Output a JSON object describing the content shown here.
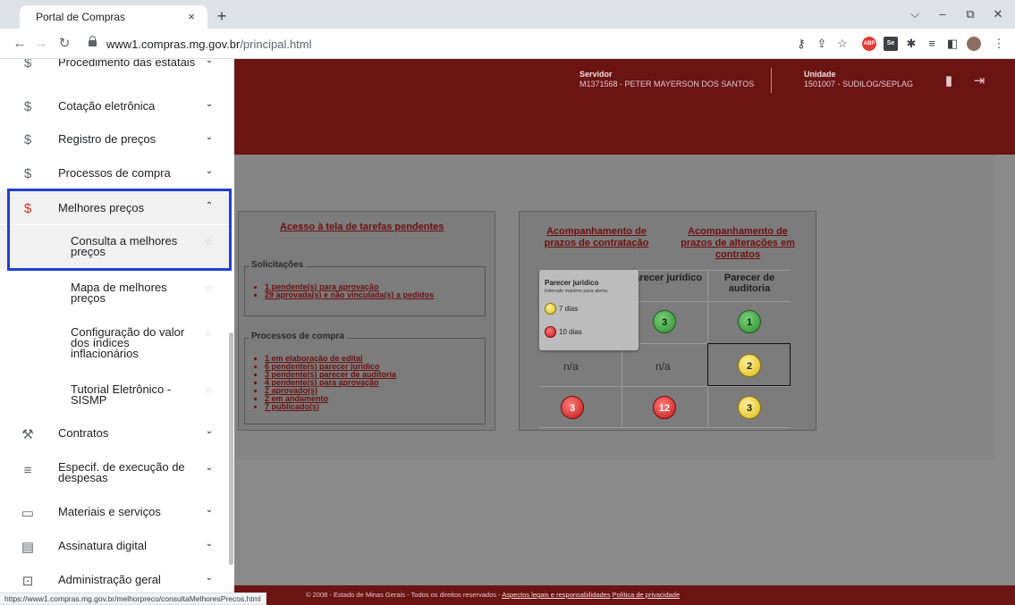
{
  "browser": {
    "tab_title": "Portal de Compras",
    "tab_close": "×",
    "new_tab": "+",
    "url_host": "www1.compras.mg.gov.br",
    "url_path": "/principal.html",
    "status_url": "https://www1.compras.mg.gov.br/melhorpreco/consultaMelhoresPrecos.html"
  },
  "banner": {
    "servidor_label": "Servidor",
    "servidor_value": "M1371568 - PETER MAYERSON DOS SANTOS",
    "unidade_label": "Unidade",
    "unidade_value": "1501007 - SUDILOG/SEPLAG"
  },
  "sidebar": {
    "items": [
      {
        "label": "Procedimento das estatais",
        "icon": "dollar-icon"
      },
      {
        "label": "Cotação eletrônica",
        "icon": "dollar-icon"
      },
      {
        "label": "Registro de preços",
        "icon": "dollar-icon"
      },
      {
        "label": "Processos de compra",
        "icon": "dollar-icon"
      },
      {
        "label": "Melhores preços",
        "icon": "dollar-icon"
      },
      {
        "label": "Contratos",
        "icon": "gavel-icon"
      },
      {
        "label": "Especif. de execução de despesas",
        "icon": "list-check-icon"
      },
      {
        "label": "Materiais e serviços",
        "icon": "book-icon"
      },
      {
        "label": "Assinatura digital",
        "icon": "document-icon"
      },
      {
        "label": "Administração geral",
        "icon": "settings-box-icon"
      }
    ],
    "subitems": [
      {
        "label": "Consulta a melhores preços"
      },
      {
        "label": "Mapa de melhores preços"
      },
      {
        "label": "Configuração do valor dos índices inflacionários"
      },
      {
        "label": "Tutorial Eletrônico - SISMP"
      }
    ]
  },
  "main": {
    "pending_link": "Acesso à tela de tarefas pendentes",
    "solicitacoes": {
      "legend": "Solicitações",
      "items": [
        "1 pendente(s) para aprovação",
        "29 aprovada(s) e não vinculada(s) a pedidos"
      ]
    },
    "processos": {
      "legend": "Processos de compra",
      "items": [
        "1 em elaboração de edital",
        "6 pendente(s) parecer jurídico",
        "3 pendente(s) parecer de auditoria",
        "4 pendente(s) para aprovação",
        "2 aprovado(s)",
        "2 em andamento",
        "7 publicado(s)"
      ]
    },
    "prazos_contratacao": "Acompanhamento de prazos de contratação",
    "prazos_alteracoes": "Acompanhamento de prazos de alterações em contratos",
    "grid": {
      "col_juridico": "Parecer jurídico",
      "col_auditoria": "Parecer de auditoria",
      "row1": {
        "juridico": "3",
        "auditoria": "1"
      },
      "row2": {
        "first": "n/a",
        "juridico": "n/a",
        "auditoria": "2"
      },
      "row3": {
        "first": "3",
        "juridico": "12",
        "auditoria": "3"
      }
    },
    "tooltip": {
      "title": "Parecer jurídico",
      "subtitle": "Intervalo máximo para alerta:",
      "yellow": "7 dias",
      "red": "10 dias"
    }
  },
  "footer": {
    "text": "© 2008 - Estado de Minas Gerais - Todos os direitos reservados - ",
    "link1": "Aspectos legais e responsabilidades",
    "link2": "Política de privacidade"
  },
  "colors": {
    "banner": "#6a1414",
    "active_icon": "#d32f2f",
    "highlight_border": "#1f3fd6"
  }
}
